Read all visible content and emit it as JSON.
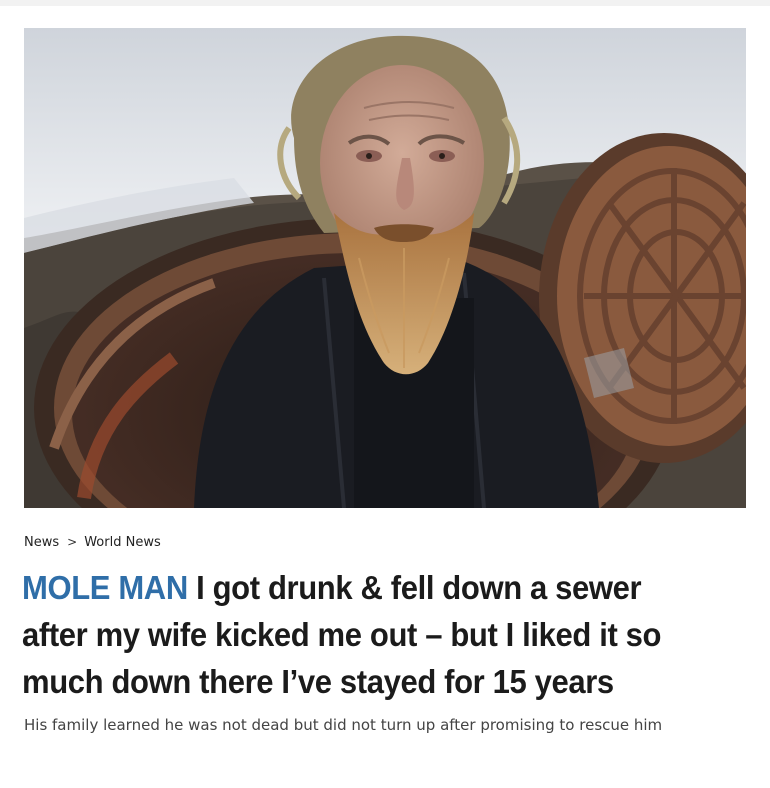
{
  "article": {
    "image": {
      "depicts": "bearded-man-emerging-from-open-manhole",
      "colors": {
        "snow": "#e6e9ee",
        "ground": "#5a5147",
        "cover_rust": "#8a5a3e",
        "jacket": "#1a1c22",
        "beard": "#b88a56",
        "skin": "#c89f8c"
      }
    },
    "breadcrumb": {
      "items": [
        "News",
        "World News"
      ],
      "separator": ">"
    },
    "headline": {
      "kicker": "MOLE MAN",
      "text": "I got drunk & fell down a sewer after my wife kicked me out – but I liked it so much down there I’ve stayed for 15 years"
    },
    "standfirst": "His family learned he was not dead but did not turn up after promising to rescue him",
    "colors": {
      "kicker": "#2f6ea8",
      "headline": "#1b1b1b",
      "standfirst": "#444444"
    }
  }
}
